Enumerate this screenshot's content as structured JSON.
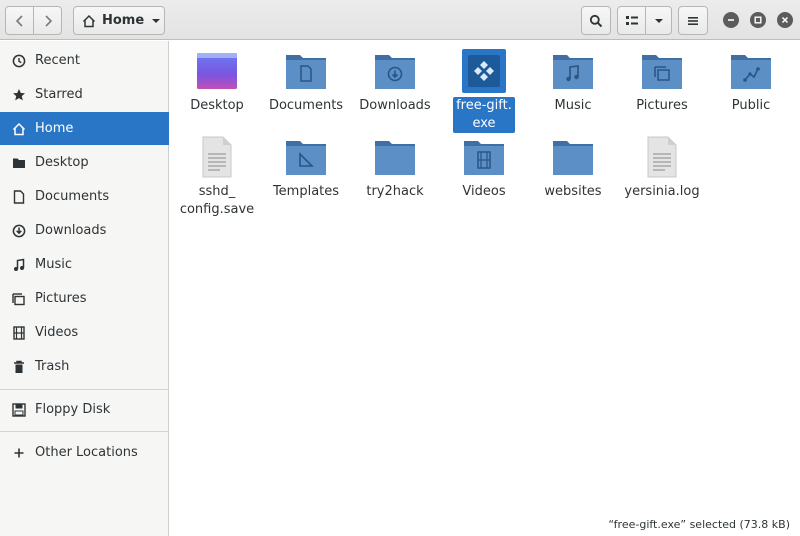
{
  "header": {
    "path_label": "Home",
    "icons": {
      "back": "chevron-left-icon",
      "forward": "chevron-right-icon",
      "home": "home-icon",
      "dropdown": "chevron-down-icon",
      "search": "search-icon",
      "view": "list-view-icon",
      "menu": "hamburger-menu-icon",
      "minimize": "minimize-icon",
      "maximize": "maximize-icon",
      "close": "close-icon"
    }
  },
  "sidebar": {
    "items": [
      {
        "label": "Recent",
        "icon": "clock-icon"
      },
      {
        "label": "Starred",
        "icon": "star-icon"
      },
      {
        "label": "Home",
        "icon": "home-icon",
        "active": true
      },
      {
        "label": "Desktop",
        "icon": "folder-icon"
      },
      {
        "label": "Documents",
        "icon": "document-icon"
      },
      {
        "label": "Downloads",
        "icon": "download-icon"
      },
      {
        "label": "Music",
        "icon": "music-note-icon"
      },
      {
        "label": "Pictures",
        "icon": "pictures-icon"
      },
      {
        "label": "Videos",
        "icon": "film-icon"
      },
      {
        "label": "Trash",
        "icon": "trash-icon"
      }
    ],
    "devices": [
      {
        "label": "Floppy Disk",
        "icon": "floppy-disk-icon"
      }
    ],
    "other": {
      "label": "Other Locations",
      "icon": "plus-icon"
    }
  },
  "files": [
    {
      "name": "Desktop",
      "icon": "desktop-folder-icon"
    },
    {
      "name": "Documents",
      "icon": "documents-folder-icon"
    },
    {
      "name": "Downloads",
      "icon": "downloads-folder-icon"
    },
    {
      "name": "free-gift.exe",
      "display": [
        "free-gift.",
        "exe"
      ],
      "icon": "executable-icon",
      "selected": true
    },
    {
      "name": "Music",
      "icon": "music-folder-icon"
    },
    {
      "name": "Pictures",
      "icon": "pictures-folder-icon"
    },
    {
      "name": "Public",
      "icon": "public-folder-icon"
    },
    {
      "name": "sshd_config.save",
      "display": [
        "sshd_",
        "config.save"
      ],
      "icon": "text-file-icon"
    },
    {
      "name": "Templates",
      "icon": "templates-folder-icon"
    },
    {
      "name": "try2hack",
      "icon": "folder-icon"
    },
    {
      "name": "Videos",
      "icon": "videos-folder-icon"
    },
    {
      "name": "websites",
      "icon": "folder-icon"
    },
    {
      "name": "yersinia.log",
      "icon": "log-file-icon"
    }
  ],
  "status": {
    "text": "“free-gift.exe” selected  (73.8 kB)"
  },
  "colors": {
    "accent": "#2a76c6",
    "folder": "#4f86bd",
    "folder_light": "#6a9fd4"
  }
}
